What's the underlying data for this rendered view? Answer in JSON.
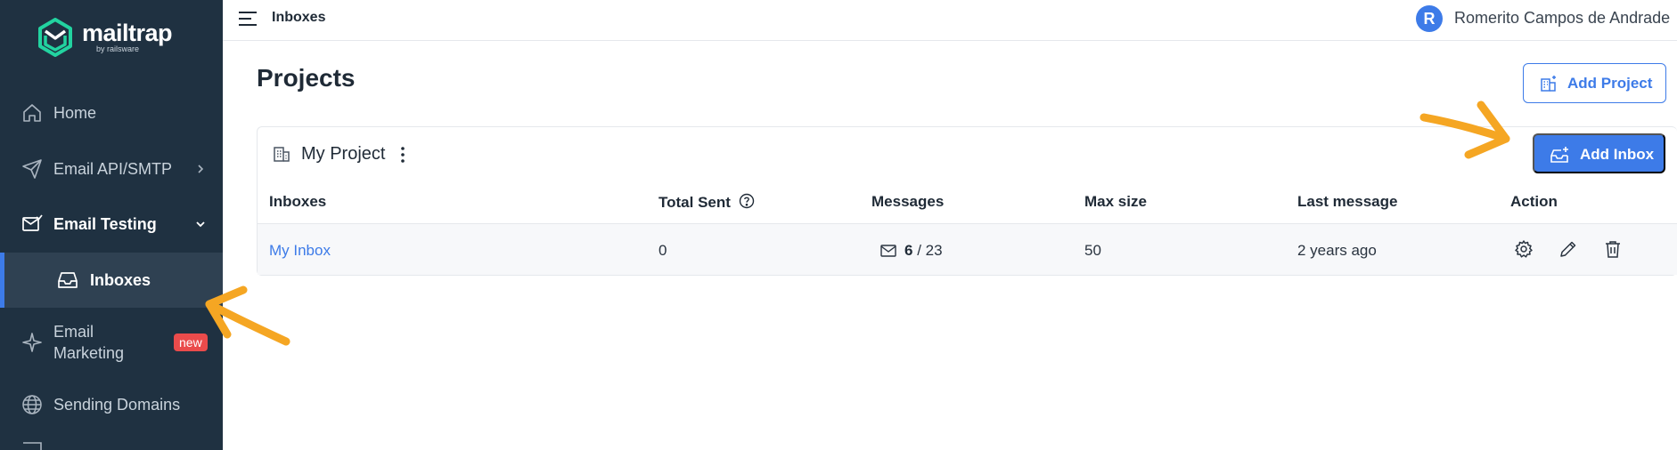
{
  "sidebar": {
    "logo": {
      "name": "mailtrap",
      "sub": "by railsware"
    },
    "items": [
      {
        "label": "Home",
        "icon": "home-icon"
      },
      {
        "label": "Email API/SMTP",
        "icon": "send-icon"
      },
      {
        "label": "Email Testing",
        "icon": "mail-check-icon"
      },
      {
        "label": "Inboxes",
        "icon": "inbox-icon"
      },
      {
        "label_line1": "Email",
        "label_line2": "Marketing",
        "badge": "new",
        "icon": "sparkle-icon"
      },
      {
        "label": "Sending Domains",
        "icon": "globe-icon"
      }
    ]
  },
  "topbar": {
    "breadcrumb": "Inboxes",
    "avatar_letter": "R",
    "user_name": "Romerito Campos de Andrade"
  },
  "main": {
    "title": "Projects",
    "add_project_label": "Add Project",
    "project": {
      "name": "My Project",
      "add_inbox_label": "Add Inbox",
      "columns": [
        "Inboxes",
        "Total Sent",
        "Messages",
        "Max size",
        "Last message",
        "Action"
      ],
      "rows": [
        {
          "inbox": "My Inbox",
          "total_sent": "0",
          "messages_unread": "6",
          "messages_total": "/ 23",
          "max_size": "50",
          "last_message": "2 years ago"
        }
      ]
    }
  },
  "colors": {
    "sidebar_bg": "#1f3141",
    "accent": "#3d7be8",
    "badge": "#ea4b4b",
    "annotation_arrow": "#f5a623"
  }
}
